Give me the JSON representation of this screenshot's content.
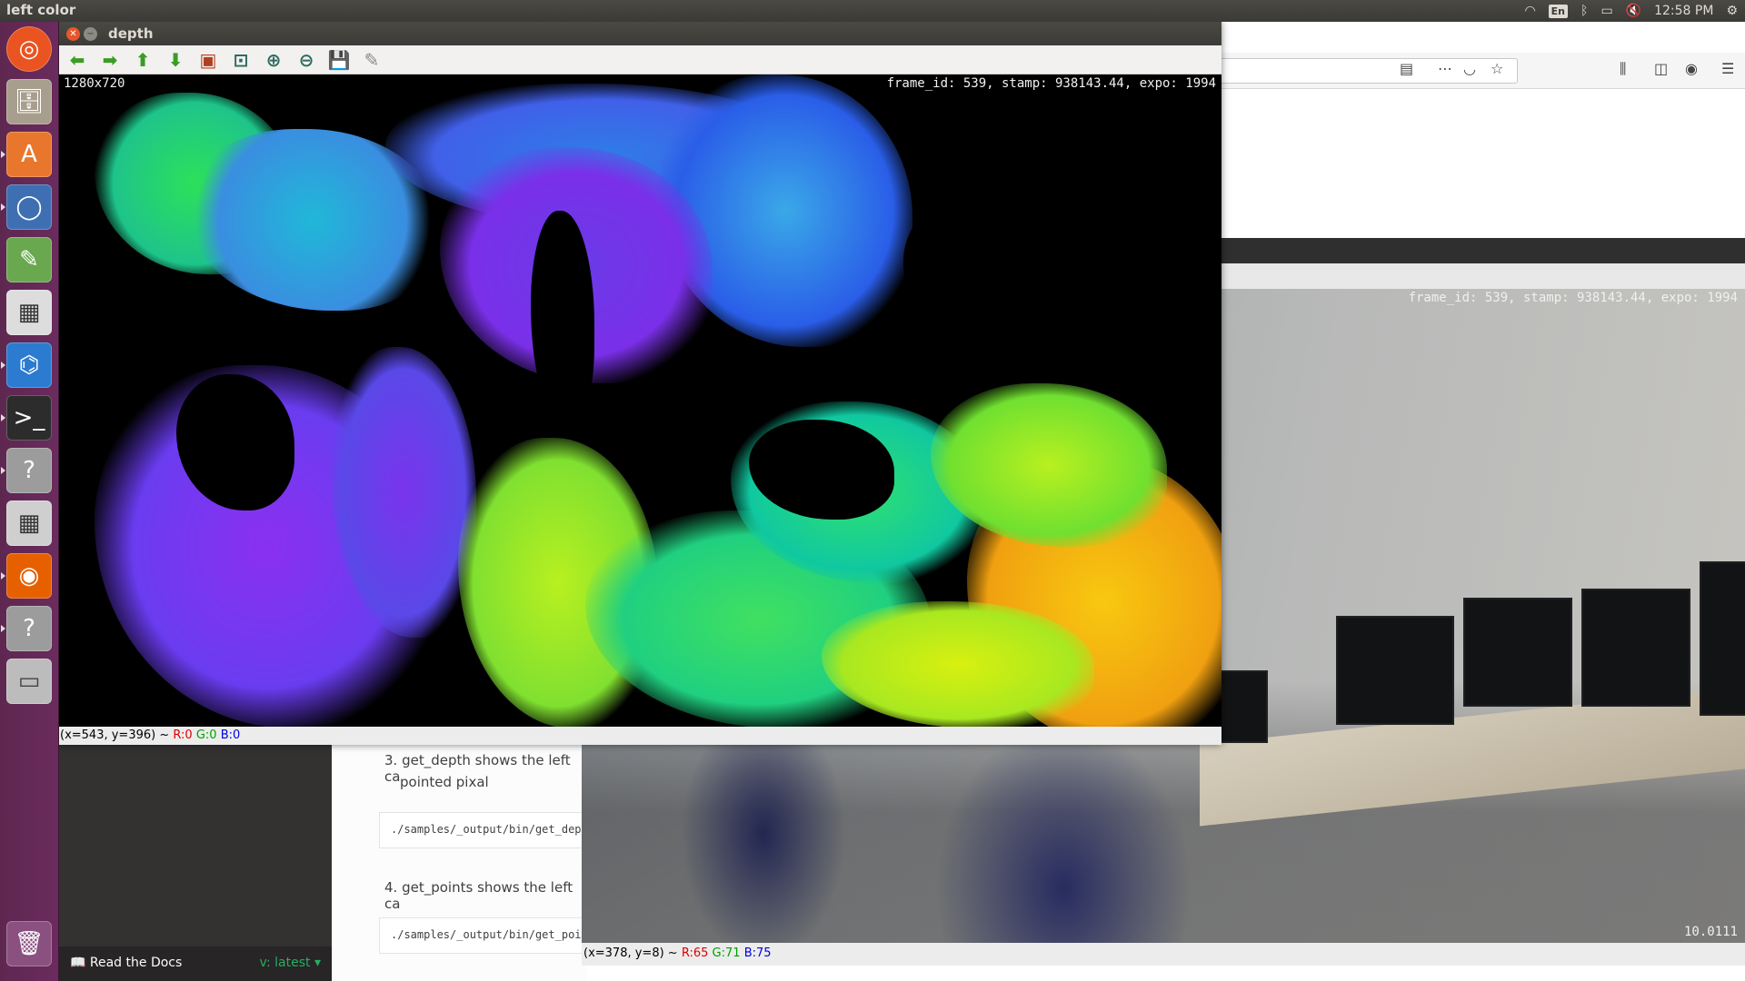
{
  "top_panel": {
    "title": "left color",
    "language": "En",
    "time": "12:58 PM"
  },
  "launcher": {
    "items": [
      "ubuntu-dash-icon",
      "files-icon",
      "software-center-icon",
      "chromium-icon",
      "text-editor-icon",
      "system-monitor-icon",
      "vscode-icon",
      "terminal-icon",
      "unknown-app-icon",
      "calculator-icon",
      "firefox-icon",
      "unknown-app-icon",
      "drive-icon",
      "trash-icon"
    ]
  },
  "depth_window": {
    "title": "depth",
    "resolution": "1280x720",
    "info": "frame_id: 539, stamp: 938143.44, expo: 1994",
    "status": {
      "coords": "(x=543, y=396) ~",
      "r": "R:0",
      "g": "G:0",
      "b": "B:0"
    }
  },
  "left_color_window": {
    "info": "frame_id: 539, stamp: 938143.44, expo: 1994",
    "value": "10.0111",
    "status": {
      "coords": "(x=378, y=8) ~",
      "r": "R:65",
      "g": "G:71",
      "b": "B:75"
    }
  },
  "docs": {
    "item3_num": "3.",
    "item3_text": "get_depth shows the left ca",
    "item3_text2": "pointed pixal",
    "code1": "./samples/_output/bin/get_dept",
    "item4_num": "4.",
    "item4_text": "get_points shows the left ca",
    "code2": "./samples/_output/bin/get_poin",
    "footer_name": "Read the Docs",
    "footer_version": "v: latest"
  },
  "colors": {
    "launcher": "#5e2750",
    "panel": "#3c3b37",
    "close": "#e9562a"
  }
}
